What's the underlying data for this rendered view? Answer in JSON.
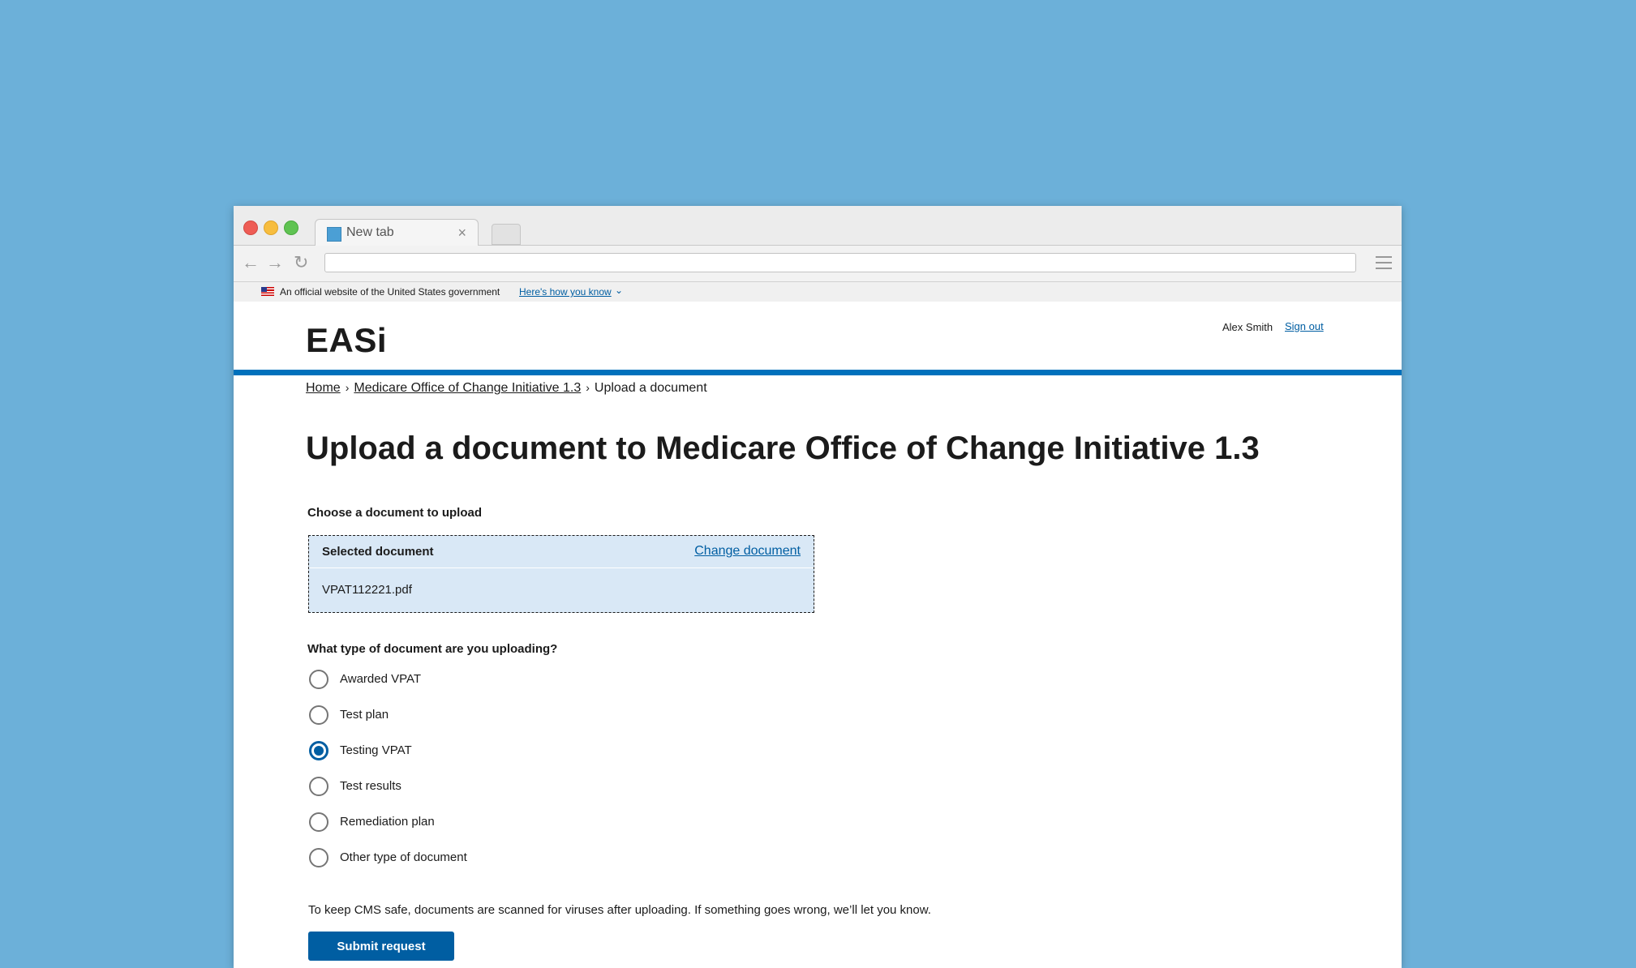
{
  "browser": {
    "tab_title": "New tab",
    "tab_close": "×",
    "nav": {
      "back": "←",
      "forward": "→",
      "reload": "↻"
    }
  },
  "gov_banner": {
    "text": "An official website of the United States government",
    "link": "Here's how you know",
    "chevron": "⌄"
  },
  "header": {
    "logo": "EASi",
    "user_name": "Alex Smith",
    "sign_out": "Sign out"
  },
  "breadcrumb": {
    "items": [
      "Home",
      "Medicare Office of Change Initiative 1.3",
      "Upload a document"
    ],
    "separator": "›"
  },
  "page": {
    "title": "Upload a document to Medicare Office of Change Initiative 1.3",
    "upload_label": "Choose a document to upload",
    "selected_label": "Selected document",
    "change_link": "Change document",
    "file_name": "VPAT112221.pdf",
    "question": "What type of document are you uploading?",
    "options": [
      {
        "label": "Awarded VPAT",
        "checked": false
      },
      {
        "label": "Test plan",
        "checked": false
      },
      {
        "label": "Testing VPAT",
        "checked": true
      },
      {
        "label": "Test results",
        "checked": false
      },
      {
        "label": "Remediation plan",
        "checked": false
      },
      {
        "label": "Other type of document",
        "checked": false
      }
    ],
    "note": "To keep CMS safe, documents are scanned for viruses after uploading. If something goes wrong, we’ll let you know.",
    "submit": "Submit request"
  },
  "colors": {
    "background": "#6cb0d9",
    "primary": "#005ea2",
    "header_rule": "#0071bc",
    "file_box": "#d9e8f6"
  }
}
